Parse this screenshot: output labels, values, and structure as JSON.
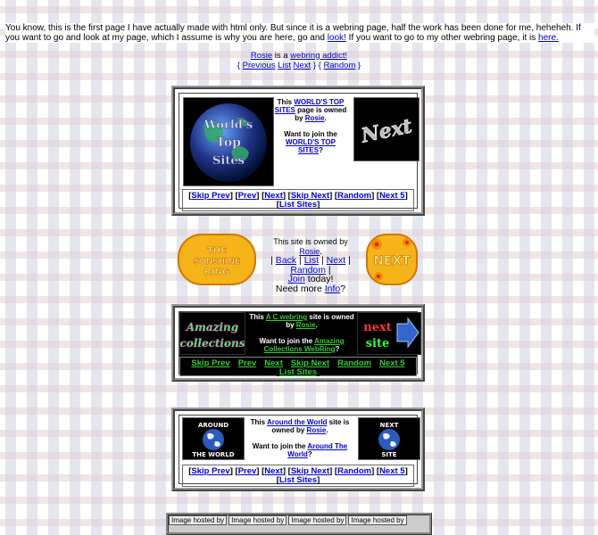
{
  "intro": {
    "text": "You know, this is the first page I have actually made with html only. But since it is a webring page, half the work has been done for me, heheheh. If you want to go and look at my page, which I assume is why you are here, go and ",
    "link1": "look!",
    "middle": " If you want to go to my other webring page, it is ",
    "link2": "here."
  },
  "addict": {
    "rosie": "Rosie",
    "is_a": " is a ",
    "webring_link": "webring addict!",
    "brace_open": "{ ",
    "previous": "Previous",
    "list": "List",
    "next": "Next",
    "mid": " } { ",
    "random": "Random",
    "brace_close": " }"
  },
  "ring1": {
    "logo_text": "World's Top Sites",
    "this": "This ",
    "site_name": "WORLD'S TOP SITES",
    "owned": " page is owned by ",
    "owner": "Rosie",
    "join": "Want to join the ",
    "join_site": "WORLD'S TOP SITES",
    "q": "?",
    "side_text": "Next"
  },
  "nav": {
    "skip_prev": "Skip Prev",
    "prev": "Prev",
    "next": "Next",
    "skip_next": "Skip Next",
    "random": "Random",
    "next5": "Next 5",
    "list_sites": "List Sites"
  },
  "sunshine": {
    "left_text": "THE SUNSHINE RING",
    "owned": "This site is owned by ",
    "owner": "Rosie",
    "back": "Back",
    "list": "List",
    "next": "Next",
    "random": "Random",
    "join": "Join",
    "today": " today!",
    "need": "Need more ",
    "info": "Info",
    "right_text": "NEXT"
  },
  "ring3": {
    "left_text": "Amazing collections",
    "this": "This ",
    "site_name": "A C webring",
    "owned": " site is owned by ",
    "owner": "Rosie",
    "join": "Want to join the ",
    "join_site": "Amazing Collections WebRing",
    "q": "?",
    "right_text": "next site"
  },
  "ring4": {
    "left_text": "AROUND THE WORLD",
    "this": "This ",
    "site_name": "Around the World",
    "owned": " site is owned by ",
    "owner": "Rosie",
    "join": "Want to join the ",
    "join_site": "Around The World",
    "q": "?",
    "right_top": "NEXT",
    "right_bottom": "SITE"
  },
  "footer": {
    "cells": [
      "Image hosted by",
      "Image hosted by",
      "Image hosted by",
      "Image hosted by"
    ]
  },
  "colors": {
    "link": "#0000cc",
    "dark_link": "#33cc33"
  }
}
